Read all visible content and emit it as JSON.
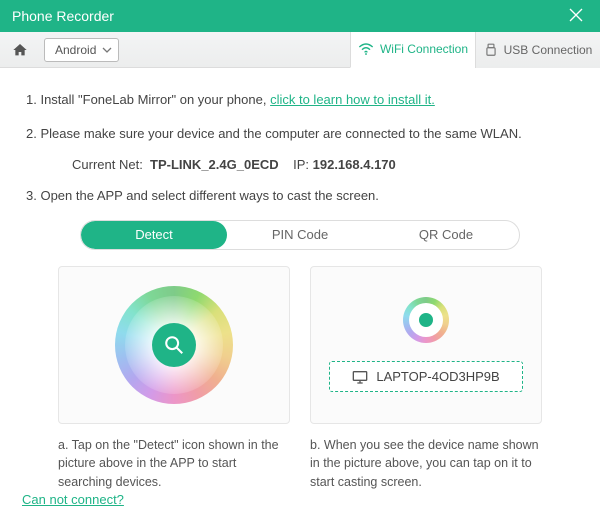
{
  "window": {
    "title": "Phone Recorder"
  },
  "toolbar": {
    "platform": "Android",
    "tabs": {
      "wifi": "WiFi Connection",
      "usb": "USB Connection"
    }
  },
  "steps": {
    "s1_prefix": "1. Install \"FoneLab Mirror\" on your phone, ",
    "s1_link": "click to learn how to install it.",
    "s2": "2. Please make sure your device and the computer are connected to the same WLAN.",
    "net_label": "Current Net:",
    "net_value": "TP-LINK_2.4G_0ECD",
    "ip_label": "IP:",
    "ip_value": "192.168.4.170",
    "s3": "3. Open the APP and select different ways to cast the screen."
  },
  "modes": {
    "detect": "Detect",
    "pin": "PIN Code",
    "qr": "QR Code"
  },
  "device_name": "LAPTOP-4OD3HP9B",
  "captions": {
    "a": "a. Tap on the \"Detect\" icon shown in the picture above in the APP to start searching devices.",
    "b": "b. When you see the device name shown in the picture above, you can tap on it to start casting screen."
  },
  "footer": {
    "cannot_connect": "Can not connect?"
  }
}
